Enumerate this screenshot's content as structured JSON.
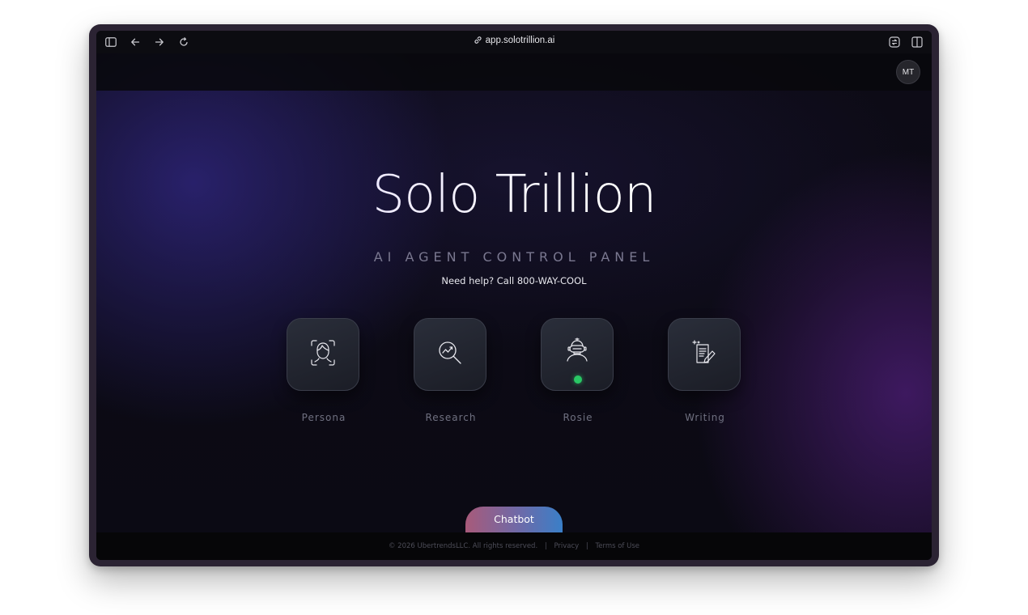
{
  "browser": {
    "url": "app.solotrillion.ai"
  },
  "header": {
    "avatar_initials": "MT"
  },
  "hero": {
    "title": "Solo Trillion",
    "subtitle": "AI AGENT CONTROL PANEL",
    "help_text": "Need help? Call 800-WAY-COOL"
  },
  "agents": [
    {
      "label": "Persona",
      "icon": "face-scan-icon"
    },
    {
      "label": "Research",
      "icon": "research-magnifier-icon"
    },
    {
      "label": "Rosie",
      "icon": "robot-icon",
      "status": "online"
    },
    {
      "label": "Writing",
      "icon": "document-pen-icon"
    }
  ],
  "chatbot": {
    "label": "Chatbot"
  },
  "footer": {
    "copyright": "© 2026 UbertrendsLLC. All rights reserved.",
    "privacy": "Privacy",
    "terms": "Terms of Use"
  },
  "colors": {
    "status_online": "#29c764",
    "background": "#0b0a14"
  }
}
